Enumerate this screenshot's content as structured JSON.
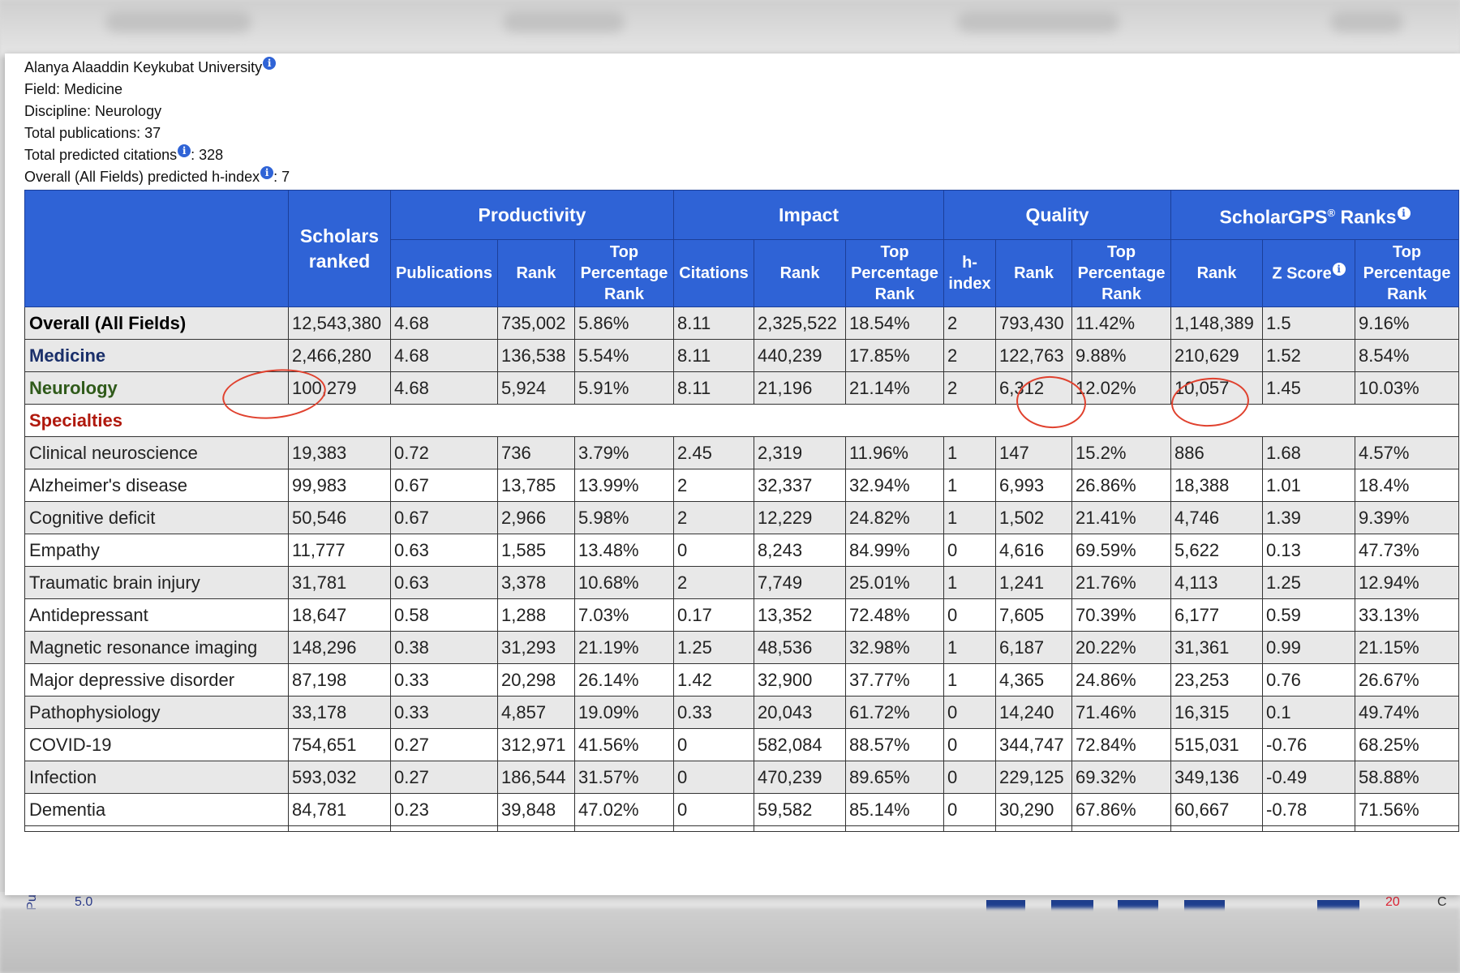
{
  "info": {
    "university": "Alanya Alaaddin Keykubat University",
    "field": "Field: Medicine",
    "discipline": "Discipline: Neurology",
    "total_publications": "Total publications: 37",
    "total_citations_label": "Total predicted citations",
    "total_citations_value": ": 328",
    "hindex_label": "Overall (All Fields) predicted h-index",
    "hindex_value": ": 7",
    "info_glyph": "i"
  },
  "table": {
    "groups": {
      "scholars": "Scholars ranked",
      "productivity": "Productivity",
      "impact": "Impact",
      "quality": "Quality",
      "scholargps": "ScholarGPS",
      "scholargps_mark": "®",
      "scholargps_suffix": " Ranks"
    },
    "subheaders": {
      "publications": "Publications",
      "rank": "Rank",
      "top_pct": "Top Percentage Rank",
      "citations": "Citations",
      "hindex": "h-index",
      "zscore": "Z Score"
    },
    "summary_rows": [
      {
        "label": "Overall (All Fields)",
        "values": [
          "12,543,380",
          "4.68",
          "735,002",
          "5.86%",
          "8.11",
          "2,325,522",
          "18.54%",
          "2",
          "793,430",
          "11.42%",
          "1,148,389",
          "1.5",
          "9.16%"
        ]
      },
      {
        "label": "Medicine",
        "values": [
          "2,466,280",
          "4.68",
          "136,538",
          "5.54%",
          "8.11",
          "440,239",
          "17.85%",
          "2",
          "122,763",
          "9.88%",
          "210,629",
          "1.52",
          "8.54%"
        ]
      },
      {
        "label": "Neurology",
        "values": [
          "100,279",
          "4.68",
          "5,924",
          "5.91%",
          "8.11",
          "21,196",
          "21.14%",
          "2",
          "6,312",
          "12.02%",
          "10,057",
          "1.45",
          "10.03%"
        ]
      }
    ],
    "specialties_label": "Specialties",
    "specialty_rows": [
      {
        "label": "Clinical neuroscience",
        "values": [
          "19,383",
          "0.72",
          "736",
          "3.79%",
          "2.45",
          "2,319",
          "11.96%",
          "1",
          "147",
          "15.2%",
          "886",
          "1.68",
          "4.57%"
        ]
      },
      {
        "label": "Alzheimer's disease",
        "values": [
          "99,983",
          "0.67",
          "13,785",
          "13.99%",
          "2",
          "32,337",
          "32.94%",
          "1",
          "6,993",
          "26.86%",
          "18,388",
          "1.01",
          "18.4%"
        ]
      },
      {
        "label": "Cognitive deficit",
        "values": [
          "50,546",
          "0.67",
          "2,966",
          "5.98%",
          "2",
          "12,229",
          "24.82%",
          "1",
          "1,502",
          "21.41%",
          "4,746",
          "1.39",
          "9.39%"
        ]
      },
      {
        "label": "Empathy",
        "values": [
          "11,777",
          "0.63",
          "1,585",
          "13.48%",
          "0",
          "8,243",
          "84.99%",
          "0",
          "4,616",
          "69.59%",
          "5,622",
          "0.13",
          "47.73%"
        ]
      },
      {
        "label": "Traumatic brain injury",
        "values": [
          "31,781",
          "0.63",
          "3,378",
          "10.68%",
          "2",
          "7,749",
          "25.01%",
          "1",
          "1,241",
          "21.76%",
          "4,113",
          "1.25",
          "12.94%"
        ]
      },
      {
        "label": "Antidepressant",
        "values": [
          "18,647",
          "0.58",
          "1,288",
          "7.03%",
          "0.17",
          "13,352",
          "72.48%",
          "0",
          "7,605",
          "70.39%",
          "6,177",
          "0.59",
          "33.13%"
        ]
      },
      {
        "label": "Magnetic resonance imaging",
        "values": [
          "148,296",
          "0.38",
          "31,293",
          "21.19%",
          "1.25",
          "48,536",
          "32.98%",
          "1",
          "6,187",
          "20.22%",
          "31,361",
          "0.99",
          "21.15%"
        ]
      },
      {
        "label": "Major depressive disorder",
        "values": [
          "87,198",
          "0.33",
          "20,298",
          "26.14%",
          "1.42",
          "32,900",
          "37.77%",
          "1",
          "4,365",
          "24.86%",
          "23,253",
          "0.76",
          "26.67%"
        ]
      },
      {
        "label": "Pathophysiology",
        "values": [
          "33,178",
          "0.33",
          "4,857",
          "19.09%",
          "0.33",
          "20,043",
          "61.72%",
          "0",
          "14,240",
          "71.46%",
          "16,315",
          "0.1",
          "49.74%"
        ]
      },
      {
        "label": "COVID-19",
        "values": [
          "754,651",
          "0.27",
          "312,971",
          "41.56%",
          "0",
          "582,084",
          "88.57%",
          "0",
          "344,747",
          "72.84%",
          "515,031",
          "-0.76",
          "68.25%"
        ]
      },
      {
        "label": "Infection",
        "values": [
          "593,032",
          "0.27",
          "186,544",
          "31.57%",
          "0",
          "470,239",
          "89.65%",
          "0",
          "229,125",
          "69.32%",
          "349,136",
          "-0.49",
          "58.88%"
        ]
      },
      {
        "label": "Dementia",
        "values": [
          "84,781",
          "0.23",
          "39,848",
          "47.02%",
          "0",
          "59,582",
          "85.14%",
          "0",
          "30,290",
          "67.86%",
          "60,667",
          "-0.78",
          "71.56%"
        ]
      }
    ]
  },
  "background": {
    "axis_value": "5.0",
    "axis_label": "Pu",
    "right_value": "20",
    "right_glyph": "C"
  },
  "colors": {
    "header_blue": "#2f63d6",
    "annotation_red": "#e0412e",
    "medicine_label": "#1a2f6a",
    "neurology_label": "#2f5a1a",
    "specialties_label": "#b0180c"
  }
}
